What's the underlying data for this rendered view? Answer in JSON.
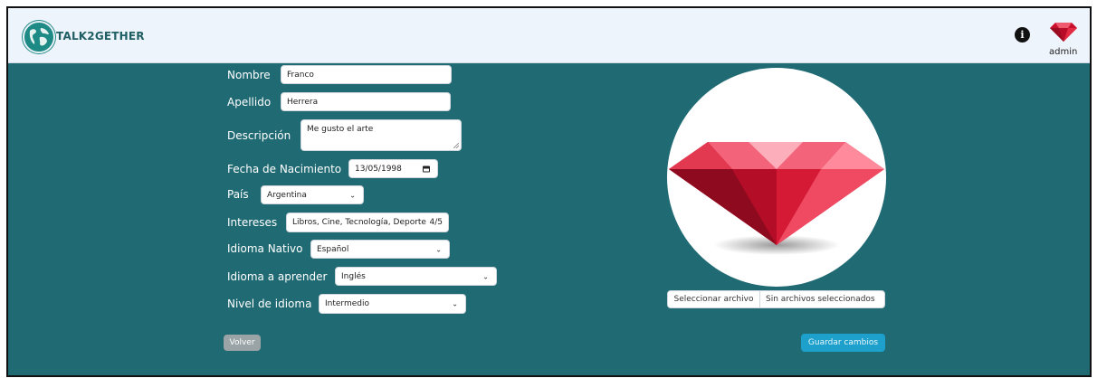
{
  "header": {
    "logo_text": "TALK2GETHER",
    "user_name": "admin",
    "info_icon": "info-icon",
    "avatar_icon": "red-gem-avatar"
  },
  "form": {
    "nombre": {
      "label": "Nombre",
      "value": "Franco"
    },
    "apellido": {
      "label": "Apellido",
      "value": "Herrera"
    },
    "descripcion": {
      "label": "Descripción",
      "value": "Me gusto el arte"
    },
    "fecha_nacimiento": {
      "label": "Fecha de Nacimiento",
      "value": "13/05/1998"
    },
    "pais": {
      "label": "País",
      "value": "Argentina"
    },
    "intereses": {
      "label": "Intereses",
      "value": "Libros, Cine, Tecnología, Deporte",
      "count": "4/5"
    },
    "idioma_nativo": {
      "label": "Idioma Nativo",
      "value": "Español"
    },
    "idioma_aprender": {
      "label": "Idioma a aprender",
      "value": "Inglés"
    },
    "nivel_idioma": {
      "label": "Nivel de idioma",
      "value": "Intermedio"
    }
  },
  "photo": {
    "select_file_label": "Seleccionar archivo",
    "file_status": "Sin archivos seleccionados"
  },
  "actions": {
    "back_label": "Volver",
    "save_label": "Guardar cambios"
  },
  "colors": {
    "background": "#206a74",
    "header": "#eef4fb",
    "save_button": "#1da0cc",
    "back_button": "#9aa3a6"
  }
}
